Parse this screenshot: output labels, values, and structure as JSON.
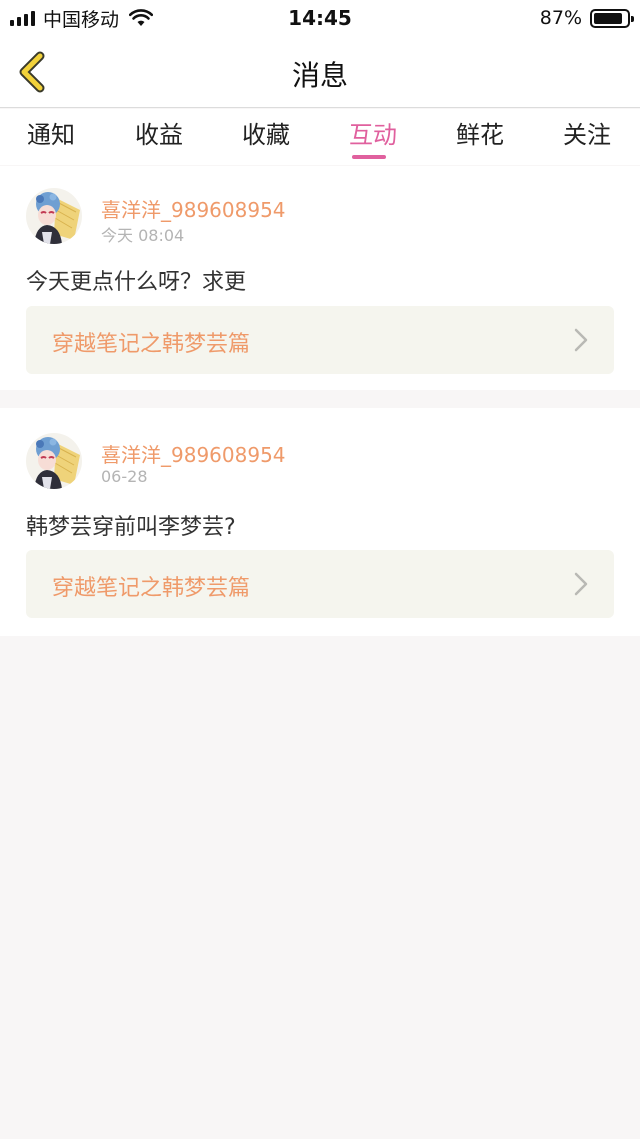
{
  "status_bar": {
    "carrier": "中国移动",
    "time": "14:45",
    "battery_percent": "87%",
    "battery_level": 0.87
  },
  "nav": {
    "title": "消息",
    "back_icon": "chevron-left-icon"
  },
  "tabs": [
    {
      "label": "通知",
      "active": false
    },
    {
      "label": "收益",
      "active": false
    },
    {
      "label": "收藏",
      "active": false
    },
    {
      "label": "互动",
      "active": true
    },
    {
      "label": "鲜花",
      "active": false
    },
    {
      "label": "关注",
      "active": false
    }
  ],
  "messages": [
    {
      "username": "喜洋洋_989608954",
      "time": "今天 08:04",
      "text": "今天更点什么呀？求更",
      "book_title": "穿越笔记之韩梦芸篇"
    },
    {
      "username": "喜洋洋_989608954",
      "time": "06-28",
      "text": "韩梦芸穿前叫李梦芸?",
      "book_title": "穿越笔记之韩梦芸篇"
    }
  ],
  "colors": {
    "accent_pink": "#e0609e",
    "username_orange": "#ef9a6a",
    "back_yellow": "#f2d23a"
  }
}
